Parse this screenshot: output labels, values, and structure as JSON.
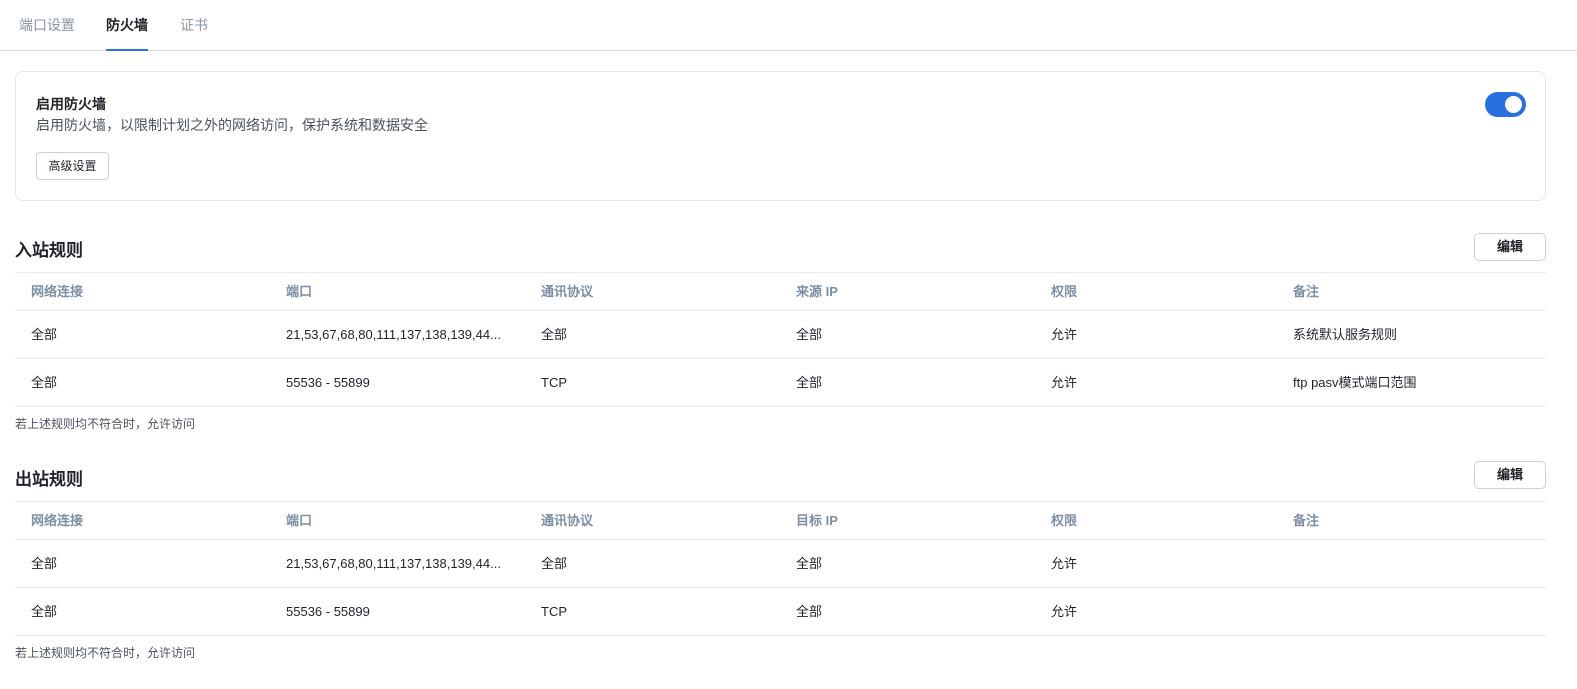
{
  "tabs": [
    {
      "label": "端口设置"
    },
    {
      "label": "防火墙"
    },
    {
      "label": "证书"
    }
  ],
  "firewall": {
    "title": "启用防火墙",
    "description": "启用防火墙，以限制计划之外的网络访问，保护系统和数据安全",
    "advanced_label": "高级设置",
    "enabled": true,
    "accent_color": "#2a6fe0"
  },
  "inbound": {
    "title": "入站规则",
    "edit_label": "编辑",
    "headers": [
      "网络连接",
      "端口",
      "通讯协议",
      "来源 IP",
      "权限",
      "备注"
    ],
    "rows": [
      [
        "全部",
        "21,53,67,68,80,111,137,138,139,44...",
        "全部",
        "全部",
        "允许",
        "系统默认服务规则"
      ],
      [
        "全部",
        "55536 - 55899",
        "TCP",
        "全部",
        "允许",
        "ftp pasv模式端口范围"
      ]
    ],
    "note": "若上述规则均不符合时，允许访问"
  },
  "outbound": {
    "title": "出站规则",
    "edit_label": "编辑",
    "headers": [
      "网络连接",
      "端口",
      "通讯协议",
      "目标 IP",
      "权限",
      "备注"
    ],
    "rows": [
      [
        "全部",
        "21,53,67,68,80,111,137,138,139,44...",
        "全部",
        "全部",
        "允许",
        ""
      ],
      [
        "全部",
        "55536 - 55899",
        "TCP",
        "全部",
        "允许",
        ""
      ]
    ],
    "note": "若上述规则均不符合时，允许访问"
  }
}
